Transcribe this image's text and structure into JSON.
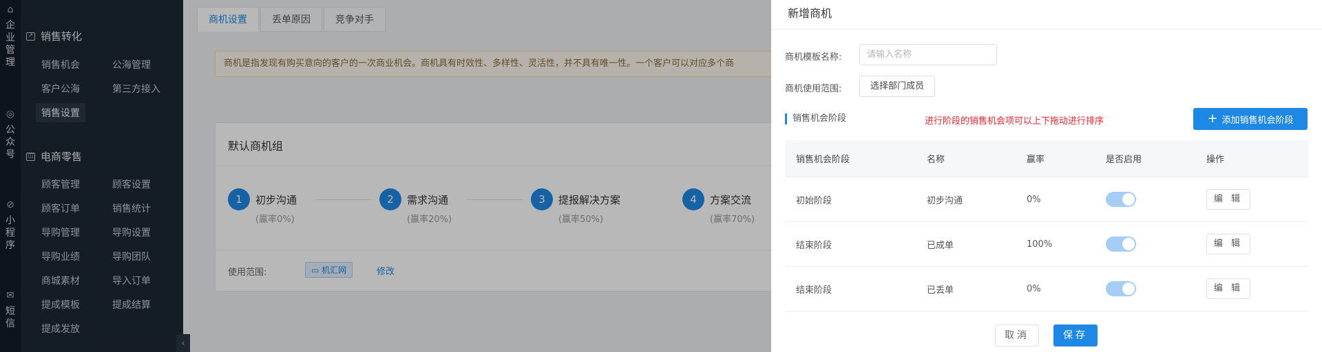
{
  "rail": [
    {
      "icon": "building-icon",
      "label": "企业管理"
    },
    {
      "icon": "wechat-icon",
      "label": "公众号"
    },
    {
      "icon": "compass-icon",
      "label": "小程序"
    },
    {
      "icon": "mail-icon",
      "label": "短信"
    }
  ],
  "sidebar": {
    "group1": {
      "title": "销售转化",
      "items": [
        "销售机会",
        "公海管理",
        "客户公海",
        "第三方接入",
        "销售设置"
      ],
      "active": "销售设置"
    },
    "group2": {
      "title": "电商零售",
      "items": [
        "顾客管理",
        "顾客设置",
        "顾客订单",
        "销售统计",
        "导购管理",
        "导购设置",
        "导购业绩",
        "导购团队",
        "商城素材",
        "导入订单",
        "提成模板",
        "提成结算",
        "提成发放"
      ]
    }
  },
  "main": {
    "tabs": [
      "商机设置",
      "丢单原因",
      "竞争对手"
    ],
    "notice": "商机是指发现有购买意向的客户的一次商业机会。商机具有时效性、多样性、灵活性，并不具有唯一性。一个客户可以对应多个商",
    "card": {
      "title": "默认商机组",
      "steps": [
        {
          "num": "1",
          "name": "初步沟通",
          "rate": "(赢率0%)"
        },
        {
          "num": "2",
          "name": "需求沟通",
          "rate": "(赢率20%)"
        },
        {
          "num": "3",
          "name": "提报解决方案",
          "rate": "(赢率50%)"
        },
        {
          "num": "4",
          "name": "方案交流",
          "rate": "(赢率70%)"
        }
      ],
      "scope_label": "使用范围:",
      "scope_tag": "机汇网",
      "scope_edit": "修改"
    }
  },
  "drawer": {
    "title": "新增商机",
    "name_label": "商机模板名称:",
    "name_placeholder": "请输入名称",
    "scope_label": "商机使用范围:",
    "scope_button": "选择部门成员",
    "section_title": "销售机会阶段",
    "hint": "进行阶段的销售机会项可以上下拖动进行排序",
    "add_button": "添加销售机会阶段",
    "table": {
      "headers": [
        "销售机会阶段",
        "名称",
        "赢率",
        "是否启用",
        "操作"
      ],
      "rows": [
        {
          "stage": "初始阶段",
          "name": "初步沟通",
          "rate": "0%",
          "enabled": true,
          "action": "编 辑"
        },
        {
          "stage": "结束阶段",
          "name": "已成单",
          "rate": "100%",
          "enabled": true,
          "action": "编 辑"
        },
        {
          "stage": "结束阶段",
          "name": "已丢单",
          "rate": "0%",
          "enabled": true,
          "action": "编 辑"
        }
      ]
    },
    "cancel": "取消",
    "save": "保存"
  },
  "colors": {
    "accent": "#1e88e5",
    "danger": "#f5222d",
    "sidebar": "#1d2733"
  }
}
